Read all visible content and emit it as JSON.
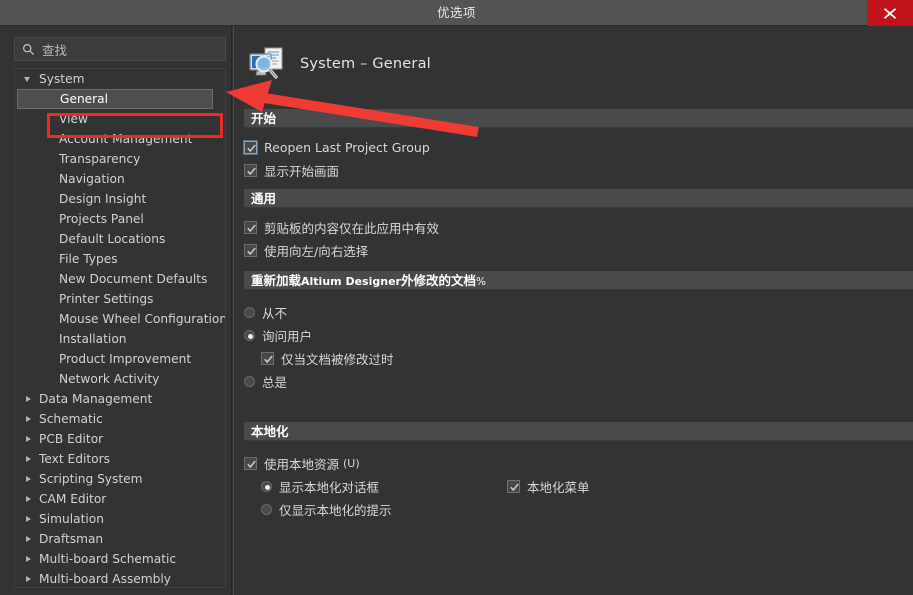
{
  "window": {
    "title": "优选项",
    "close_label": "✕"
  },
  "sidebar": {
    "search": {
      "placeholder": "查找",
      "value": "",
      "icon": "search-icon"
    },
    "tree": [
      {
        "label": "System",
        "level": 0,
        "state": "expanded",
        "selected": false
      },
      {
        "label": "General",
        "level": 1,
        "state": "leaf",
        "selected": true
      },
      {
        "label": "View",
        "level": 1,
        "state": "leaf",
        "selected": false
      },
      {
        "label": "Account Management",
        "level": 1,
        "state": "leaf",
        "selected": false
      },
      {
        "label": "Transparency",
        "level": 1,
        "state": "leaf",
        "selected": false
      },
      {
        "label": "Navigation",
        "level": 1,
        "state": "leaf",
        "selected": false
      },
      {
        "label": "Design Insight",
        "level": 1,
        "state": "leaf",
        "selected": false
      },
      {
        "label": "Projects Panel",
        "level": 1,
        "state": "leaf",
        "selected": false
      },
      {
        "label": "Default Locations",
        "level": 1,
        "state": "leaf",
        "selected": false
      },
      {
        "label": "File Types",
        "level": 1,
        "state": "leaf",
        "selected": false
      },
      {
        "label": "New Document Defaults",
        "level": 1,
        "state": "leaf",
        "selected": false
      },
      {
        "label": "Printer Settings",
        "level": 1,
        "state": "leaf",
        "selected": false
      },
      {
        "label": "Mouse Wheel Configuration",
        "level": 1,
        "state": "leaf",
        "selected": false
      },
      {
        "label": "Installation",
        "level": 1,
        "state": "leaf",
        "selected": false
      },
      {
        "label": "Product Improvement",
        "level": 1,
        "state": "leaf",
        "selected": false
      },
      {
        "label": "Network Activity",
        "level": 1,
        "state": "leaf",
        "selected": false
      },
      {
        "label": "Data Management",
        "level": 0,
        "state": "collapsed",
        "selected": false
      },
      {
        "label": "Schematic",
        "level": 0,
        "state": "collapsed",
        "selected": false
      },
      {
        "label": "PCB Editor",
        "level": 0,
        "state": "collapsed",
        "selected": false
      },
      {
        "label": "Text Editors",
        "level": 0,
        "state": "collapsed",
        "selected": false
      },
      {
        "label": "Scripting System",
        "level": 0,
        "state": "collapsed",
        "selected": false
      },
      {
        "label": "CAM Editor",
        "level": 0,
        "state": "collapsed",
        "selected": false
      },
      {
        "label": "Simulation",
        "level": 0,
        "state": "collapsed",
        "selected": false
      },
      {
        "label": "Draftsman",
        "level": 0,
        "state": "collapsed",
        "selected": false
      },
      {
        "label": "Multi-board Schematic",
        "level": 0,
        "state": "collapsed",
        "selected": false
      },
      {
        "label": "Multi-board Assembly",
        "level": 0,
        "state": "collapsed",
        "selected": false
      }
    ]
  },
  "page": {
    "icon": "system-general-icon",
    "title": "System – General",
    "sections": {
      "startup": {
        "header": "开始",
        "options": [
          {
            "label": "Reopen Last Project Group",
            "type": "checkbox",
            "checked": true,
            "focused": true
          },
          {
            "label": "显示开始画面",
            "type": "checkbox",
            "checked": true,
            "focused": false
          }
        ]
      },
      "general": {
        "header": "通用",
        "options": [
          {
            "label": "剪贴板的内容仅在此应用中有效",
            "type": "checkbox",
            "checked": true
          },
          {
            "label": "使用向左/向右选择",
            "type": "checkbox",
            "checked": true
          }
        ]
      },
      "reload": {
        "header_part1": "重新加载",
        "header_latin": "Altium Designer",
        "header_part2": "外修改的文档",
        "header_suffix": "%",
        "options": [
          {
            "label": "从不",
            "type": "radio",
            "checked": false
          },
          {
            "label": "询问用户",
            "type": "radio",
            "checked": true
          },
          {
            "label": "仅当文档被修改过时",
            "type": "checkbox",
            "checked": true,
            "indent": 2
          },
          {
            "label": "总是",
            "type": "radio",
            "checked": false
          }
        ]
      },
      "localization": {
        "header": "本地化",
        "use_local_resources": {
          "label": "使用本地资源",
          "mnemonic": "(U)",
          "type": "checkbox",
          "checked": true
        },
        "show_localized_dialogs": {
          "label": "显示本地化对话框",
          "type": "radio",
          "checked": true
        },
        "localized_menus": {
          "label": "本地化菜单",
          "type": "checkbox",
          "checked": true
        },
        "show_localized_hints_only": {
          "label": "仅显示本地化的提示",
          "type": "radio",
          "checked": false
        }
      }
    }
  },
  "annotations": {
    "highlight_box_color": "#ef2a25",
    "arrow_color": "#ef3b33",
    "arrow_points_to": "General"
  },
  "colors": {
    "window_bg": "#333333",
    "titlebar_bg": "#545454",
    "close_btn": "#c0131a",
    "section_header_bg": "#4a4a4a",
    "selection_bg": "#4e4e4e",
    "text": "#d6d6d6"
  }
}
